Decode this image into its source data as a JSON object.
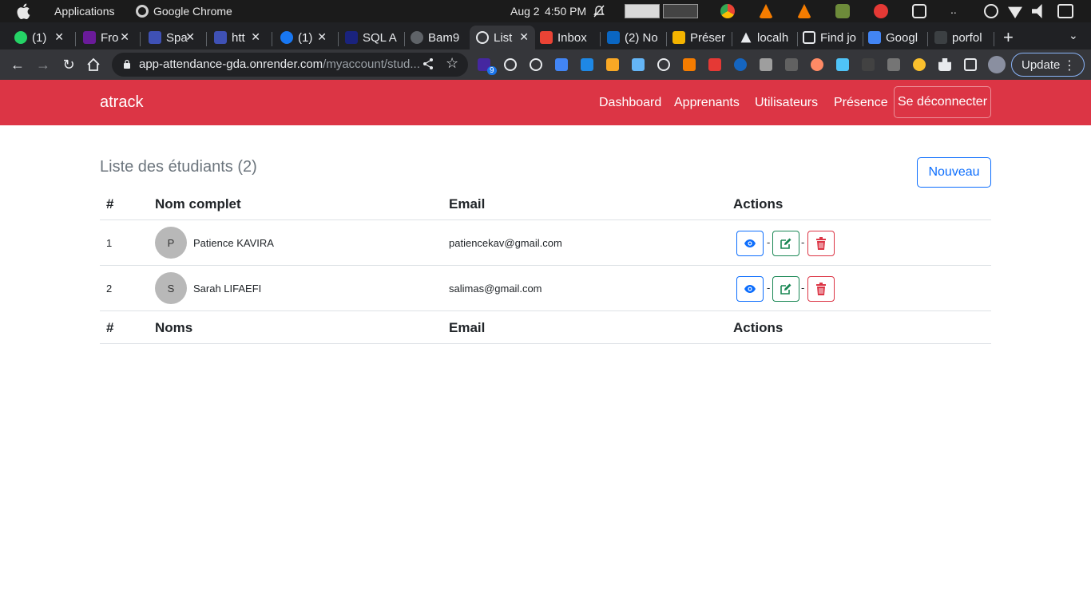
{
  "os": {
    "applications": "Applications",
    "active_app": "Google Chrome",
    "date": "Aug 2",
    "time": "4:50 PM",
    "overflow": ".."
  },
  "browser": {
    "tabs": [
      {
        "label": "(1)",
        "icon": "whatsapp-icon",
        "color": "#25d366"
      },
      {
        "label": "Fro",
        "icon": "plus-icon",
        "color": "#8e24aa"
      },
      {
        "label": "Spa",
        "icon": "star-icon",
        "color": "#3f51b5"
      },
      {
        "label": "htt",
        "icon": "star-icon",
        "color": "#3f51b5"
      },
      {
        "label": "(1)",
        "icon": "facebook-icon",
        "color": "#1877f2"
      },
      {
        "label": "SQL A",
        "icon": "sql-icon",
        "color": "#1a237e"
      },
      {
        "label": "Bam9",
        "icon": "github-icon",
        "color": "#9aa0a6"
      },
      {
        "label": "List",
        "icon": "globe-icon",
        "color": "#e8eaed"
      },
      {
        "label": "Inbox",
        "icon": "gmail-icon",
        "color": "#ea4335"
      },
      {
        "label": "(2) No",
        "icon": "linkedin-icon",
        "color": "#0a66c2"
      },
      {
        "label": "Préser",
        "icon": "slides-icon",
        "color": "#f4b400"
      },
      {
        "label": "localh",
        "icon": "triangle-icon",
        "color": "#e8eaed"
      },
      {
        "label": "Find jo",
        "icon": "findjob-icon",
        "color": "#e8eaed"
      },
      {
        "label": "Googl",
        "icon": "translate-icon",
        "color": "#4285f4"
      },
      {
        "label": "porfol",
        "icon": "s-icon",
        "color": "#3c4043"
      }
    ],
    "url_host": "app-attendance-gda.onrender.com",
    "url_path": "/myaccount/stud...",
    "update_label": "Update",
    "extension_badge": "9"
  },
  "app": {
    "brand": "atrack",
    "nav": {
      "dashboard": "Dashboard",
      "apprenants": "Apprenants",
      "utilisateurs": "Utilisateurs",
      "presence": "Présence",
      "logout": "Se déconnecter"
    },
    "title": "Liste des étudiants (2)",
    "new_button": "Nouveau",
    "table": {
      "headers": [
        "#",
        "Nom complet",
        "Email",
        "Actions"
      ],
      "footers": [
        "#",
        "Noms",
        "Email",
        "Actions"
      ],
      "rows": [
        {
          "index": "1",
          "initial": "P",
          "name": "Patience KAVIRA",
          "email": "patiencekav@gmail.com"
        },
        {
          "index": "2",
          "initial": "S",
          "name": "Sarah LIFAEFI",
          "email": "salimas@gmail.com"
        }
      ],
      "separator": "-"
    }
  },
  "colors": {
    "navbar": "#dc3545",
    "primary": "#0d6efd",
    "success": "#198754",
    "danger": "#dc3545"
  }
}
